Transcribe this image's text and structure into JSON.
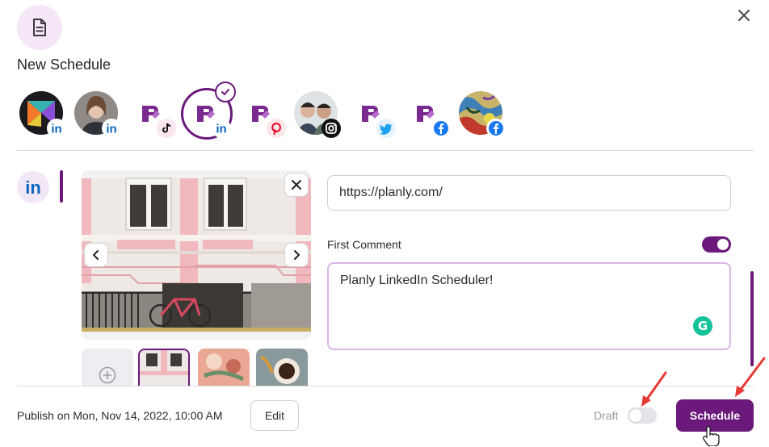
{
  "header": {
    "icon": "document-icon",
    "title": "New Schedule",
    "close_icon": "close-icon"
  },
  "accounts": [
    {
      "avatar": "brand-logo",
      "network": "linkedin",
      "selected": false
    },
    {
      "avatar": "person-photo",
      "network": "linkedin",
      "selected": false
    },
    {
      "avatar": "planly-logo",
      "network": "tiktok",
      "selected": false
    },
    {
      "avatar": "planly-logo",
      "network": "linkedin",
      "selected": true
    },
    {
      "avatar": "planly-logo",
      "network": "pinterest",
      "selected": false
    },
    {
      "avatar": "people-photo",
      "network": "instagram",
      "selected": false
    },
    {
      "avatar": "planly-logo",
      "network": "twitter",
      "selected": false
    },
    {
      "avatar": "planly-logo",
      "network": "facebook",
      "selected": false
    },
    {
      "avatar": "art-photo",
      "network": "facebook",
      "selected": false
    }
  ],
  "editor": {
    "active_network": "linkedin",
    "url_value": "https://planly.com/",
    "first_comment_label": "First Comment",
    "first_comment_enabled": true,
    "comment_text": "Planly LinkedIn Scheduler!"
  },
  "footer": {
    "publish_text": "Publish on Mon, Nov 14, 2022, 10:00 AM",
    "edit_label": "Edit",
    "draft_label": "Draft",
    "draft_enabled": false,
    "schedule_label": "Schedule"
  },
  "colors": {
    "brand": "#6b1a7c",
    "linkedin": "#0a66c2",
    "grammarly": "#15c39a"
  }
}
